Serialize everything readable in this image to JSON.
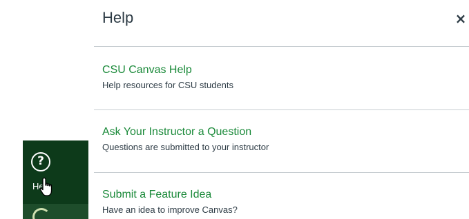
{
  "tray": {
    "title": "Help",
    "close_symbol": "×",
    "close_label": "Close"
  },
  "help_items": [
    {
      "title": "CSU Canvas Help",
      "description": "Help resources for CSU students"
    },
    {
      "title": "Ask Your Instructor a Question",
      "description": "Questions are submitted to your instructor"
    },
    {
      "title": "Submit a Feature Idea",
      "description": "Have an idea to improve Canvas?"
    }
  ],
  "global_nav": {
    "help_label": "Help",
    "help_icon": "question-circle-icon",
    "next_icon": "canvas-logo-icon"
  },
  "colors": {
    "nav_background": "#1e4d2b",
    "nav_active_background": "#0d3a1a",
    "link_green": "#1b8a3a",
    "text_dark": "#2d3b45",
    "divider": "#c7cdd1"
  }
}
